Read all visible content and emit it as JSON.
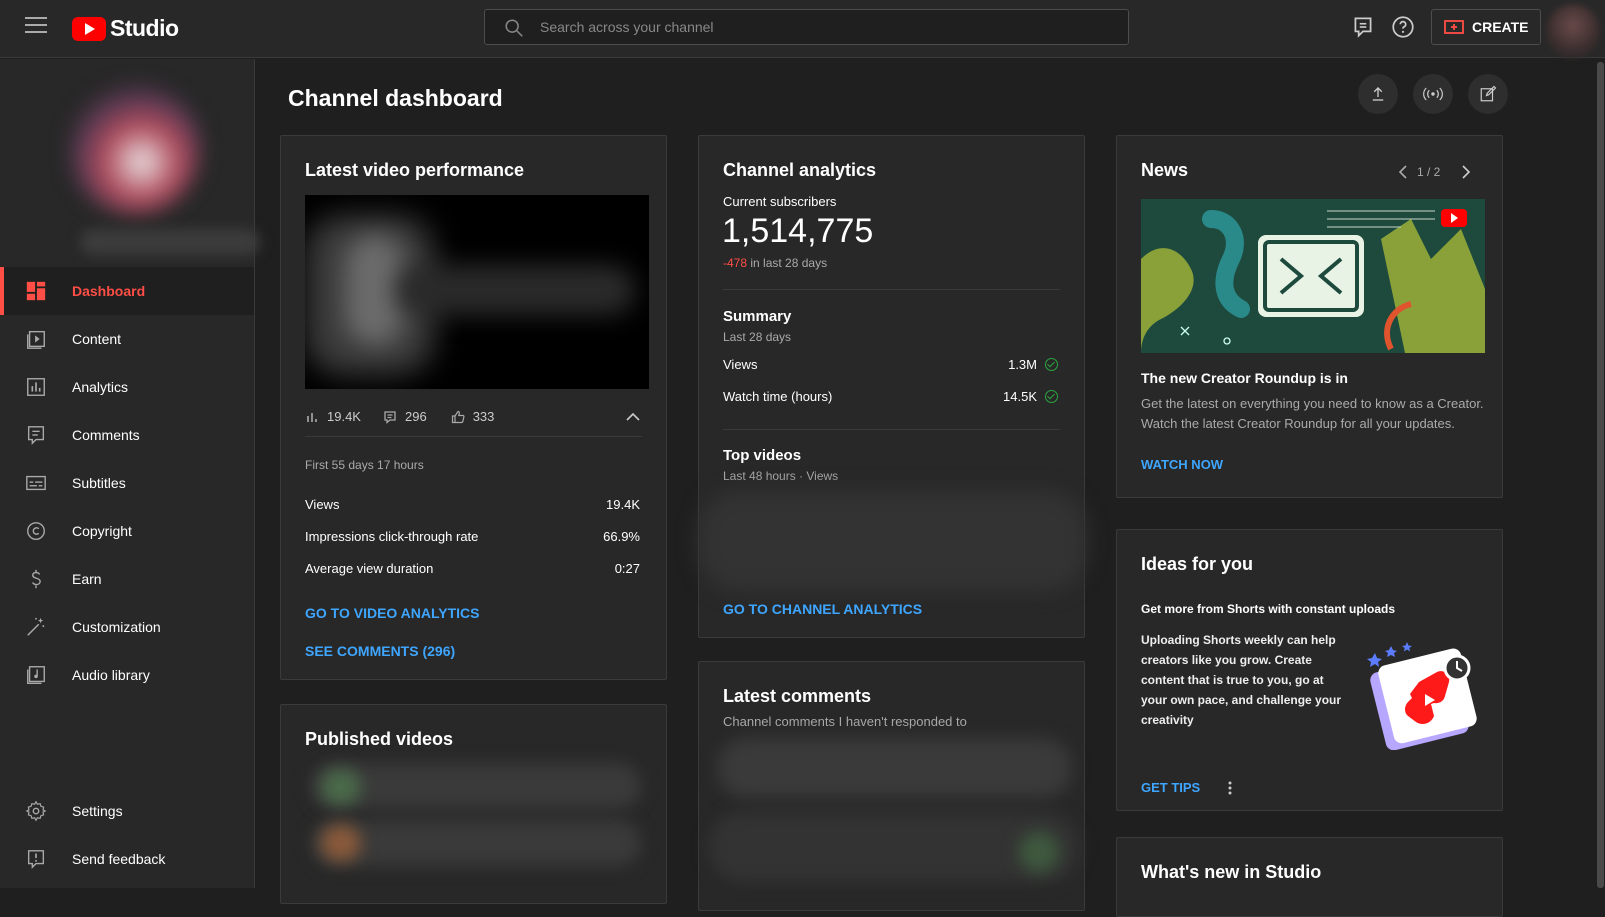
{
  "header": {
    "app_name": "Studio",
    "search_placeholder": "Search across your channel",
    "create_label": "CREATE"
  },
  "sidebar": {
    "items": [
      {
        "label": "Dashboard",
        "icon": "dashboard-icon",
        "active": true
      },
      {
        "label": "Content",
        "icon": "content-icon"
      },
      {
        "label": "Analytics",
        "icon": "analytics-icon"
      },
      {
        "label": "Comments",
        "icon": "comments-icon"
      },
      {
        "label": "Subtitles",
        "icon": "subtitles-icon"
      },
      {
        "label": "Copyright",
        "icon": "copyright-icon"
      },
      {
        "label": "Earn",
        "icon": "dollar-icon"
      },
      {
        "label": "Customization",
        "icon": "wand-icon"
      },
      {
        "label": "Audio library",
        "icon": "audio-library-icon"
      }
    ],
    "bottom_items": [
      {
        "label": "Settings",
        "icon": "gear-icon"
      },
      {
        "label": "Send feedback",
        "icon": "feedback-icon"
      }
    ]
  },
  "page": {
    "title": "Channel dashboard"
  },
  "latest_video": {
    "title": "Latest video performance",
    "views": "19.4K",
    "comments": "296",
    "likes": "333",
    "period": "First 55 days 17 hours",
    "metrics": [
      {
        "label": "Views",
        "value": "19.4K"
      },
      {
        "label": "Impressions click-through rate",
        "value": "66.9%"
      },
      {
        "label": "Average view duration",
        "value": "0:27"
      }
    ],
    "analytics_link": "GO TO VIDEO ANALYTICS",
    "comments_link": "SEE COMMENTS (296)"
  },
  "published": {
    "title": "Published videos"
  },
  "channel_analytics": {
    "title": "Channel analytics",
    "subs_label": "Current subscribers",
    "subs_value": "1,514,775",
    "subs_change": "-478",
    "subs_change_suffix": "in last 28 days",
    "summary_title": "Summary",
    "summary_period": "Last 28 days",
    "summary": [
      {
        "label": "Views",
        "value": "1.3M"
      },
      {
        "label": "Watch time (hours)",
        "value": "14.5K"
      }
    ],
    "top_videos_title": "Top videos",
    "top_videos_period": "Last 48 hours · Views",
    "link": "GO TO CHANNEL ANALYTICS"
  },
  "latest_comments": {
    "title": "Latest comments",
    "subtitle": "Channel comments I haven't responded to"
  },
  "news": {
    "title": "News",
    "pager": "1 / 2",
    "headline": "The new Creator Roundup is in",
    "body": "Get the latest on everything you need to know as a Creator. Watch the latest Creator Roundup for all your updates.",
    "link": "WATCH NOW"
  },
  "ideas": {
    "title": "Ideas for you",
    "headline": "Get more from Shorts with constant uploads",
    "body": "Uploading Shorts weekly can help creators like you grow. Create content that is true to you, go at your own pace, and challenge your creativity",
    "link": "GET TIPS"
  },
  "whats_new": {
    "title": "What's new in Studio"
  },
  "colors": {
    "accent": "#ff4e45",
    "link": "#3ea6ff",
    "negative": "#ff4e45",
    "positive": "#2ba640",
    "background": "#1f1f1f",
    "panel": "#282828"
  }
}
